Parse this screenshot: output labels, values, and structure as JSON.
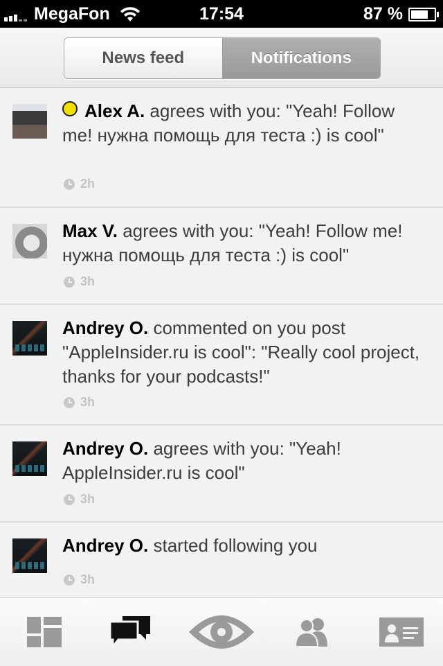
{
  "status_bar": {
    "carrier": "MegaFon",
    "time": "17:54",
    "battery": "87 %",
    "battery_level": 0.87
  },
  "segmented": {
    "news_feed": "News feed",
    "notifications": "Notifications",
    "selected": "Notifications"
  },
  "feed": [
    {
      "name": "Alex A.",
      "text": " agrees with you: \"Yeah! Follow me! нужна помощь для теста :) is cool\"",
      "time": "2h",
      "online": true,
      "avatar": "alex"
    },
    {
      "name": "Max V.",
      "text": " agrees with you: \"Yeah! Follow me! нужна помощь для теста :) is cool\"",
      "time": "3h",
      "online": false,
      "avatar": "max"
    },
    {
      "name": "Andrey O.",
      "text": " commented on you post \"AppleInsider.ru is cool\": \"Really cool project, thanks for your podcasts!\"",
      "time": "3h",
      "online": false,
      "avatar": "andrey"
    },
    {
      "name": "Andrey O.",
      "text": " agrees with you: \"Yeah! AppleInsider.ru is cool\"",
      "time": "3h",
      "online": false,
      "avatar": "andrey"
    },
    {
      "name": "Andrey O.",
      "text": " started following you",
      "time": "3h",
      "online": false,
      "avatar": "andrey"
    }
  ],
  "tabbar": {
    "icons": [
      "dashboard-icon",
      "chat-bubbles-icon",
      "eye-icon",
      "people-icon",
      "profile-card-icon"
    ],
    "active": "chat-bubbles-icon"
  },
  "colors": {
    "online": "#f2e100",
    "segment_active": "#a3a3a3",
    "time_text": "#c3c3c3"
  }
}
